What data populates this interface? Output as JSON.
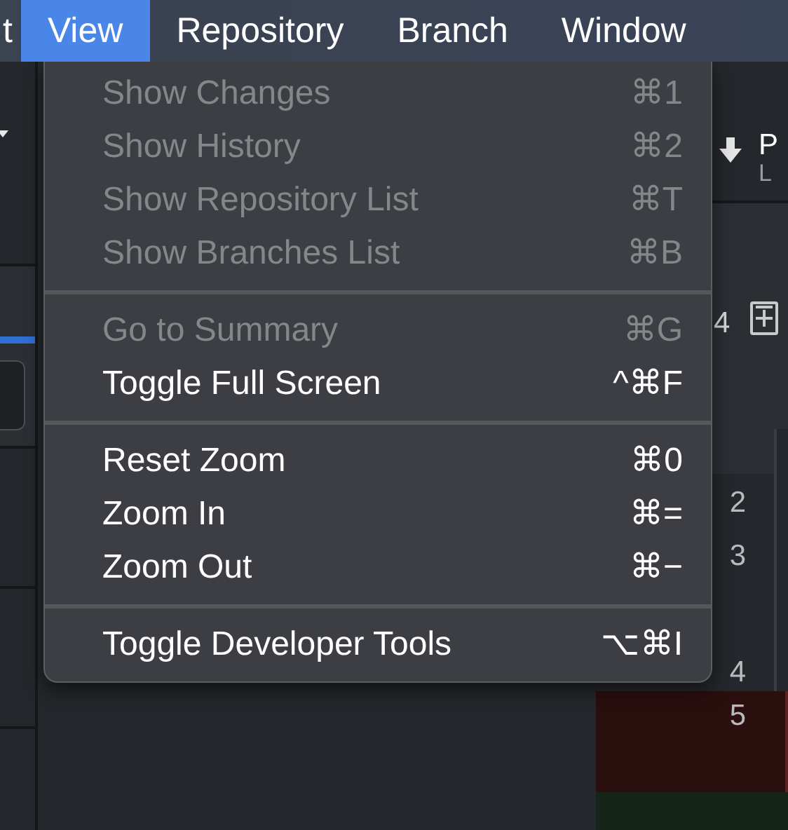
{
  "menu_bar": [
    {
      "label": "t",
      "selected": false
    },
    {
      "label": "View",
      "selected": true
    },
    {
      "label": "Repository",
      "selected": false
    },
    {
      "label": "Branch",
      "selected": false
    },
    {
      "label": "Window",
      "selected": false
    }
  ],
  "menu": {
    "sections": [
      [
        {
          "label": "Show Changes",
          "shortcut": "⌘1",
          "disabled": true
        },
        {
          "label": "Show History",
          "shortcut": "⌘2",
          "disabled": true
        },
        {
          "label": "Show Repository List",
          "shortcut": "⌘T",
          "disabled": true
        },
        {
          "label": "Show Branches List",
          "shortcut": "⌘B",
          "disabled": true
        }
      ],
      [
        {
          "label": "Go to Summary",
          "shortcut": "⌘G",
          "disabled": true
        },
        {
          "label": "Toggle Full Screen",
          "shortcut": "^⌘F",
          "disabled": false
        }
      ],
      [
        {
          "label": "Reset Zoom",
          "shortcut": "⌘0",
          "disabled": false
        },
        {
          "label": "Zoom In",
          "shortcut": "⌘=",
          "disabled": false
        },
        {
          "label": "Zoom Out",
          "shortcut": "⌘−",
          "disabled": false
        }
      ],
      [
        {
          "label": "Toggle Developer Tools",
          "shortcut": "⌥⌘I",
          "disabled": false
        }
      ]
    ]
  },
  "toolbar": {
    "title": "P",
    "subtitle": "L"
  },
  "changes": {
    "count": "4"
  },
  "diff": {
    "lines": [
      {
        "number": "2",
        "kind": "context"
      },
      {
        "number": "3",
        "kind": "context"
      },
      {
        "number": "4",
        "kind": "context"
      },
      {
        "number": "5",
        "kind": "deleted"
      }
    ]
  }
}
